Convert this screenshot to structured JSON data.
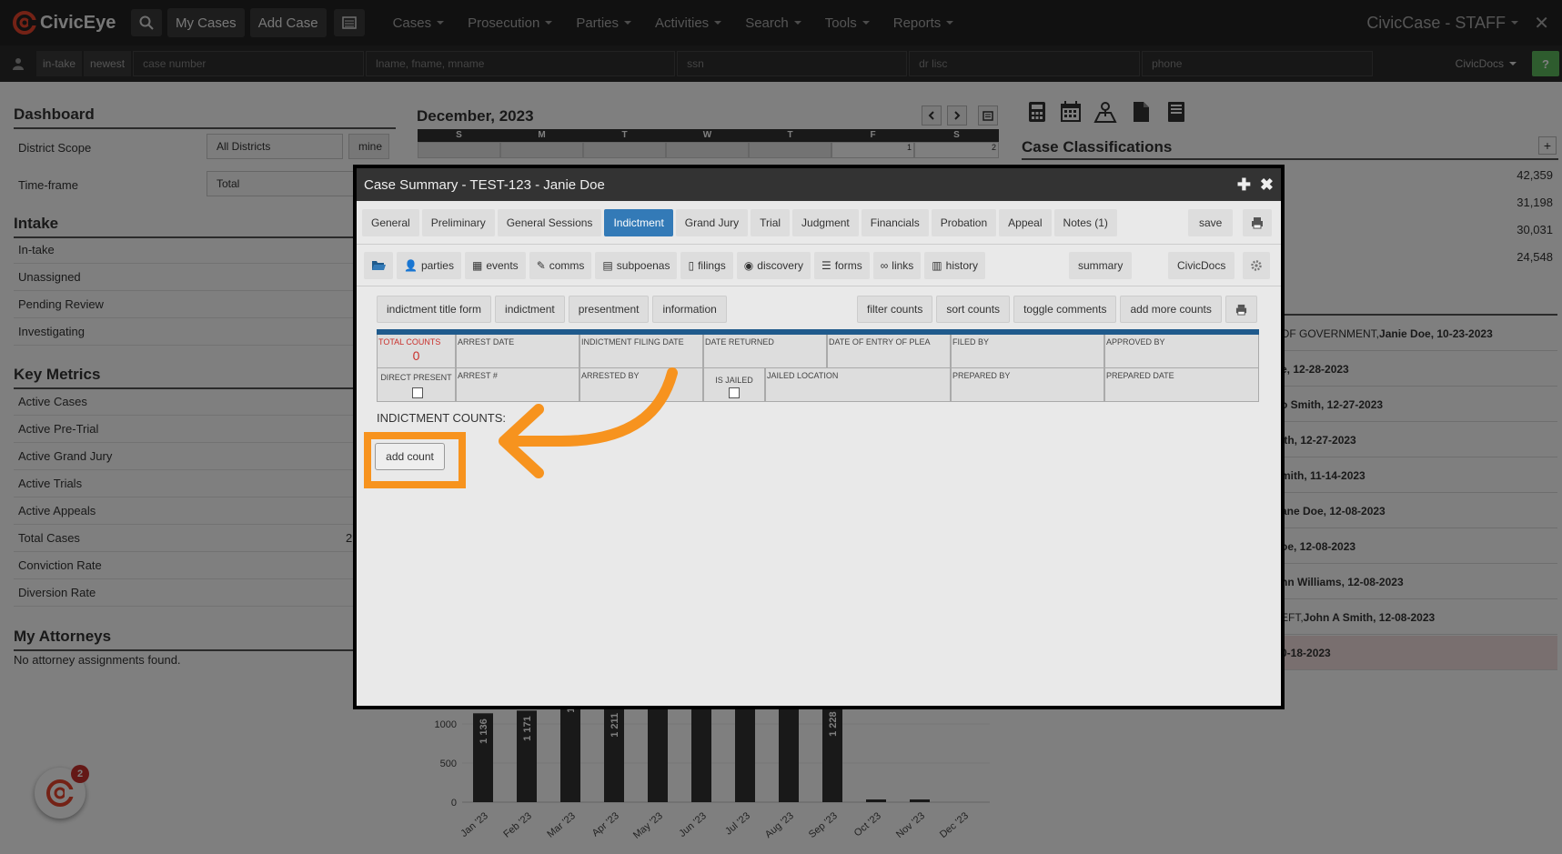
{
  "topbar": {
    "brand": "CivicEye",
    "my_cases": "My Cases",
    "add_case": "Add Case",
    "menus": [
      "Cases",
      "Prosecution",
      "Parties",
      "Activities",
      "Search",
      "Tools",
      "Reports"
    ],
    "right_brand": "CivicCase - STAFF",
    "close": "✕"
  },
  "searchbar": {
    "tags": [
      "in-take",
      "newest"
    ],
    "inputs": [
      {
        "placeholder": "case number"
      },
      {
        "placeholder": "lname, fname, mname"
      },
      {
        "placeholder": "ssn"
      },
      {
        "placeholder": "dr lisc"
      },
      {
        "placeholder": "phone"
      }
    ],
    "civicdocs": "CivicDocs",
    "help": "?"
  },
  "dashboard": {
    "title": "Dashboard",
    "district_scope_label": "District Scope",
    "district_scope_value": "All Districts",
    "mine": "mine",
    "timeframe_label": "Time-frame",
    "timeframe_value": "Total"
  },
  "intake": {
    "title": "Intake",
    "items": [
      "In-take",
      "Unassigned",
      "Pending Review",
      "Investigating"
    ]
  },
  "key_metrics": {
    "title": "Key Metrics",
    "items": [
      "Active Cases",
      "Active Pre-Trial",
      "Active Grand Jury",
      "Active Trials",
      "Active Appeals",
      "Total Cases",
      "Conviction Rate",
      "Diversion Rate"
    ],
    "total_cases_partial": "2"
  },
  "attorneys": {
    "title": "My Attorneys",
    "empty": "No attorney assignments found."
  },
  "calendar": {
    "title": "December, 2023",
    "days": [
      "S",
      "M",
      "T",
      "W",
      "T",
      "F",
      "S"
    ],
    "first_row": [
      "",
      "",
      "",
      "",
      "",
      "1",
      "2"
    ]
  },
  "classifications": {
    "title": "Case Classifications",
    "add": "+",
    "values": [
      "42,359",
      "31,198",
      "30,031",
      "24,548"
    ]
  },
  "activity": {
    "rows": [
      {
        "text": "OF GOVERNMENT, ",
        "bold": "Janie Doe, 10-23-2023"
      },
      {
        "text": "",
        "bold": "e, 12-28-2023"
      },
      {
        "text": "",
        "bold": "o Smith, 12-27-2023"
      },
      {
        "text": "",
        "bold": "ith, 12-27-2023"
      },
      {
        "text": "",
        "bold": "mith, 11-14-2023"
      },
      {
        "text": "",
        "bold": "ane Doe, 12-08-2023"
      },
      {
        "text": "",
        "bold": "oe, 12-08-2023"
      },
      {
        "text": "",
        "bold": "nn Williams, 12-08-2023"
      },
      {
        "text": "EFT, ",
        "bold": "John A Smith, 12-08-2023"
      },
      {
        "text": "",
        "bold": "0-18-2023"
      }
    ]
  },
  "chart_data": {
    "type": "bar",
    "categories": [
      "Jan '23",
      "Feb '23",
      "Mar '23",
      "Apr '23",
      "May '23",
      "Jun '23",
      "Jul '23",
      "Aug '23",
      "Sep '23",
      "Oct '23",
      "Nov '23",
      "Dec '23"
    ],
    "values": [
      1136,
      1171,
      1462,
      1211,
      1600,
      1570,
      1570,
      1600,
      1228,
      20,
      30,
      0
    ],
    "labels": [
      "1 136",
      "1 171",
      "1 46",
      "1 211",
      "1 6",
      "1 5",
      "1 5",
      "1",
      "1 228",
      "",
      "",
      ""
    ],
    "yticks": [
      0,
      500,
      1000
    ],
    "title": "",
    "xlabel": "",
    "ylabel": ""
  },
  "modal": {
    "title": "Case Summary - TEST-123 - Janie Doe",
    "tabs": [
      "General",
      "Preliminary",
      "General Sessions",
      "Indictment",
      "Grand Jury",
      "Trial",
      "Judgment",
      "Financials",
      "Probation",
      "Appeal",
      "Notes (1)"
    ],
    "active_tab": "Indictment",
    "save": "save",
    "subtabs": [
      "parties",
      "events",
      "comms",
      "subpoenas",
      "filings",
      "discovery",
      "forms",
      "links",
      "history"
    ],
    "summary": "summary",
    "civicdocs": "CivicDocs",
    "left_buttons": [
      "indictment title form",
      "indictment",
      "presentment",
      "information"
    ],
    "right_buttons": [
      "filter counts",
      "sort counts",
      "toggle comments",
      "add more counts"
    ],
    "table": {
      "row1": [
        "TOTAL COUNTS",
        "ARREST DATE",
        "INDICTMENT FILING DATE",
        "DATE RETURNED",
        "DATE OF ENTRY OF PLEA",
        "FILED BY",
        "APPROVED BY"
      ],
      "total_counts_value": "0",
      "row2": [
        "DIRECT PRESENT",
        "ARREST #",
        "ARRESTED BY",
        "IS JAILED",
        "JAILED LOCATION",
        "PREPARED BY",
        "PREPARED DATE"
      ]
    },
    "counts_label": "INDICTMENT COUNTS:",
    "add_count": "add count"
  },
  "fab": {
    "badge": "2"
  },
  "colors": {
    "accent": "#337ab7",
    "highlight": "#f7931e",
    "brand": "#e8452c"
  }
}
